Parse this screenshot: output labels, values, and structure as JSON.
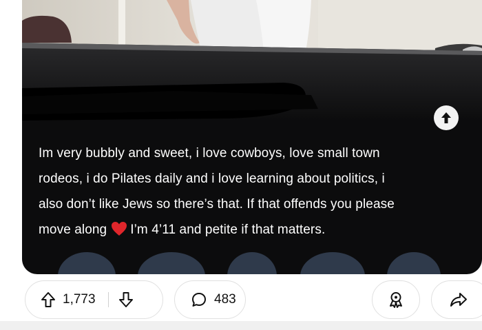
{
  "post": {
    "caption_lines": [
      "Im very bubbly and sweet, i love cowboys, love small town",
      "rodeos, i do Pilates daily and i love learning about politics, i",
      "also don’t like Jews so there’s that. If that offends you please"
    ],
    "caption_last_before": "move along",
    "caption_last_after": "I’m 4’11 and petite if that matters.",
    "heart_icon": "red-heart-emoji",
    "scroll_top_icon": "arrow-up-icon"
  },
  "actions": {
    "upvote_icon": "arrow-up-outline-icon",
    "score": "1,773",
    "downvote_icon": "arrow-down-outline-icon",
    "comment_icon": "speech-bubble-icon",
    "comments": "483",
    "award_icon": "award-icon",
    "share_icon": "share-arrow-icon"
  },
  "colors": {
    "media_bg": "#0c0c0d",
    "caption_text": "#ffffff",
    "heart": "#e0262b",
    "avatar": "#2f3a4b"
  }
}
